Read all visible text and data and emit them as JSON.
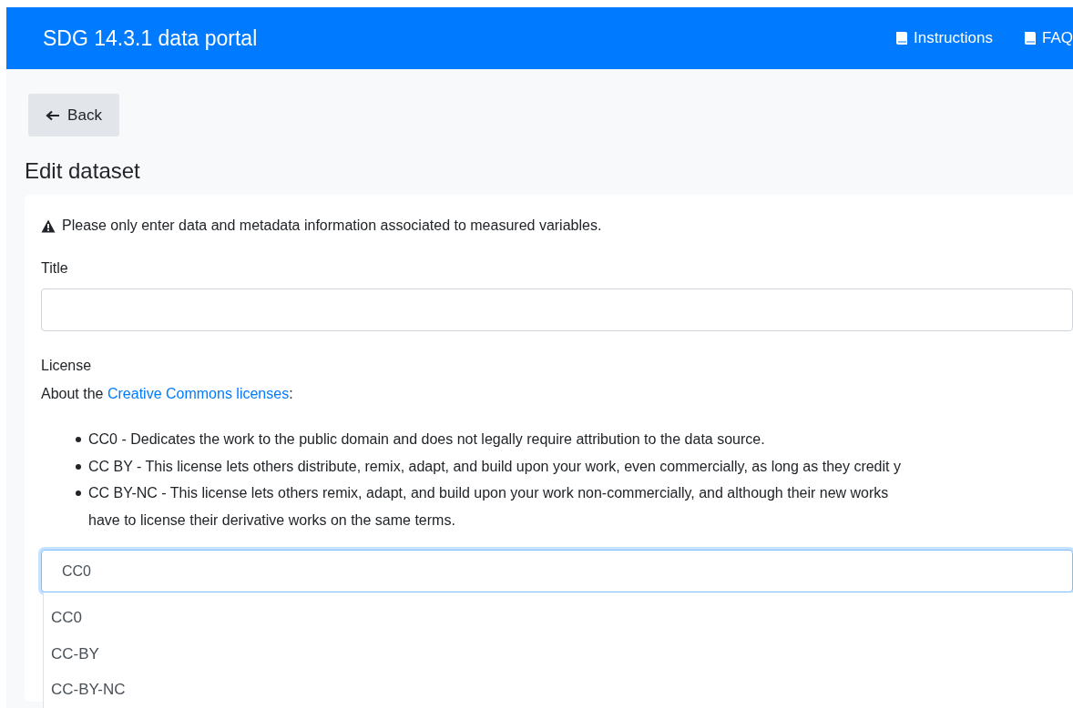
{
  "navbar": {
    "brand": "SDG 14.3.1 data portal",
    "links": [
      {
        "label": "Instructions"
      },
      {
        "label": "FAQ"
      }
    ]
  },
  "back_button": {
    "label": "Back"
  },
  "heading": "Edit dataset",
  "form": {
    "notice": "Please only enter data and metadata information associated to measured variables.",
    "title_field": {
      "label": "Title"
    },
    "license": {
      "label": "License",
      "about_prefix": "About the ",
      "about_link": "Creative Commons licenses",
      "about_suffix": ":",
      "items": [
        {
          "lines": [
            "CC0 - Dedicates the work to the public domain and does not legally require attribution to the data source."
          ]
        },
        {
          "lines": [
            "CC BY - This license lets others distribute, remix, adapt, and build upon your work, even commercially, as long as they credit y"
          ]
        },
        {
          "lines": [
            "CC BY-NC - This license lets others remix, adapt, and build upon your work non-commercially, and although their new works",
            "have to license their derivative works on the same terms."
          ]
        }
      ],
      "select": {
        "value": "CC0",
        "focused": true,
        "options": [
          {
            "label": "CC0"
          },
          {
            "label": "CC-BY"
          },
          {
            "label": "CC-BY-NC"
          }
        ]
      }
    }
  }
}
